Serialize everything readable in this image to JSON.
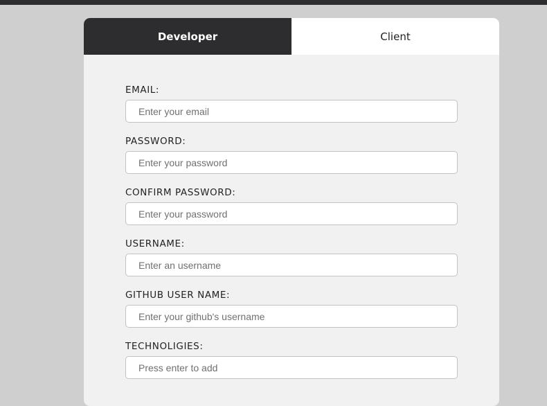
{
  "tabs": {
    "developer": "Developer",
    "client": "Client"
  },
  "form": {
    "fields": [
      {
        "label": "EMAIL:",
        "placeholder": "Enter your email",
        "value": ""
      },
      {
        "label": "PASSWORD:",
        "placeholder": "Enter your password",
        "value": ""
      },
      {
        "label": "CONFIRM PASSWORD:",
        "placeholder": "Enter your password",
        "value": ""
      },
      {
        "label": "USERNAME:",
        "placeholder": "Enter an username",
        "value": ""
      },
      {
        "label": "GITHUB USER NAME:",
        "placeholder": "Enter your github's username",
        "value": ""
      },
      {
        "label": "TECHNOLIGIES:",
        "placeholder": "Press enter to add",
        "value": ""
      }
    ]
  },
  "colors": {
    "page_background": "#cfcfcf",
    "active_tab": "#2d2d2f",
    "card_background": "#f1f1f1"
  }
}
